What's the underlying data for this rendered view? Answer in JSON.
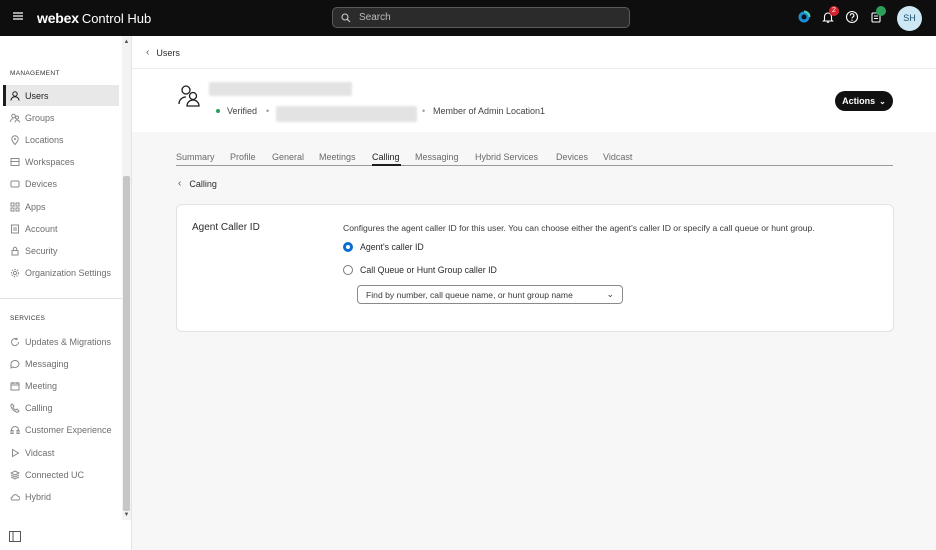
{
  "topbar": {
    "brand_bold": "webex",
    "brand_rest": "Control Hub",
    "search_placeholder": "Search",
    "notification_count": "2",
    "avatar_initials": "SH"
  },
  "sidebar": {
    "management_title": "MANAGEMENT",
    "management_items": [
      {
        "label": "Users",
        "icon": "user-icon",
        "active": true
      },
      {
        "label": "Groups",
        "icon": "groups-icon"
      },
      {
        "label": "Locations",
        "icon": "location-pin-icon"
      },
      {
        "label": "Workspaces",
        "icon": "workspace-icon"
      },
      {
        "label": "Devices",
        "icon": "device-icon"
      },
      {
        "label": "Apps",
        "icon": "apps-icon"
      },
      {
        "label": "Account",
        "icon": "account-icon"
      },
      {
        "label": "Security",
        "icon": "lock-icon"
      },
      {
        "label": "Organization Settings",
        "icon": "gear-icon"
      }
    ],
    "services_title": "SERVICES",
    "services_items": [
      {
        "label": "Updates & Migrations",
        "icon": "refresh-icon"
      },
      {
        "label": "Messaging",
        "icon": "chat-icon"
      },
      {
        "label": "Meeting",
        "icon": "calendar-icon"
      },
      {
        "label": "Calling",
        "icon": "phone-icon"
      },
      {
        "label": "Customer Experience",
        "icon": "headset-icon"
      },
      {
        "label": "Vidcast",
        "icon": "play-icon"
      },
      {
        "label": "Connected UC",
        "icon": "layers-icon"
      },
      {
        "label": "Hybrid",
        "icon": "cloud-icon"
      }
    ]
  },
  "breadcrumb": {
    "label": "Users"
  },
  "user": {
    "status": "Verified",
    "member_text": "Member of Admin Location1",
    "actions_label": "Actions"
  },
  "tabs": [
    "Summary",
    "Profile",
    "General",
    "Meetings",
    "Calling",
    "Messaging",
    "Hybrid Services",
    "Devices",
    "Vidcast"
  ],
  "active_tab": "Calling",
  "subpage": {
    "back_label": "Calling"
  },
  "card": {
    "title": "Agent Caller ID",
    "description": "Configures the agent caller ID for this user. You can choose either the agent's caller ID or specify a call queue or hunt group.",
    "options": [
      {
        "label": "Agent's caller ID",
        "selected": true
      },
      {
        "label": "Call Queue or Hunt Group caller ID",
        "selected": false
      }
    ],
    "select_placeholder": "Find by number, call queue name, or hunt group name"
  },
  "colors": {
    "accent": "#0a6ed1",
    "topbar": "#0e0e0e",
    "verified": "#2aa05a",
    "badge": "#d4242d"
  }
}
